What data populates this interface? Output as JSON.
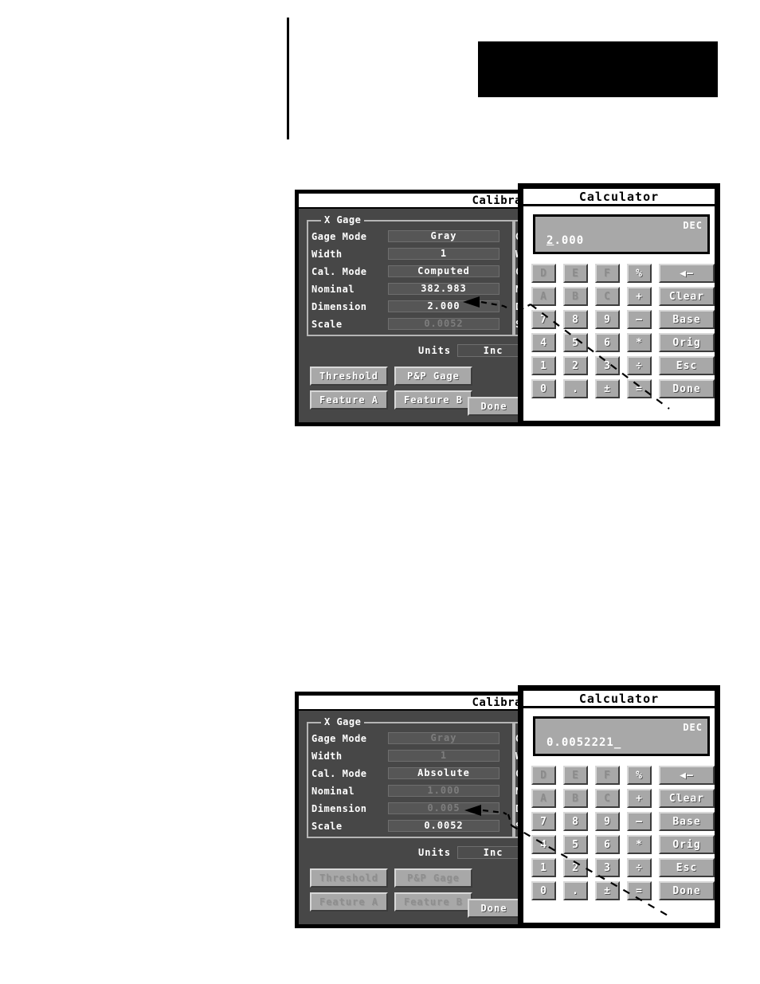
{
  "page": {
    "background": "#ffffff",
    "rule_color": "#000000"
  },
  "figures": [
    {
      "id": "figure-top",
      "calibration_window": {
        "title": "Calibra",
        "title_full_hint": "Calibra",
        "group_label": "X Gage",
        "fields": [
          {
            "label": "Gage Mode",
            "value": "Gray",
            "label_dim": false,
            "value_dim": false
          },
          {
            "label": "Width",
            "value": "1",
            "label_dim": false,
            "value_dim": false
          },
          {
            "label": "Cal. Mode",
            "value": "Computed",
            "label_dim": false,
            "value_dim": false
          },
          {
            "label": "Nominal",
            "value": "382.983",
            "label_dim": false,
            "value_dim": false
          },
          {
            "label": "Dimension",
            "value": "2.000",
            "label_dim": false,
            "value_dim": false
          },
          {
            "label": "Scale",
            "value": "0.0052",
            "label_dim": false,
            "value_dim": true
          }
        ],
        "second_gage_fields": [
          {
            "label": "G",
            "value": ""
          },
          {
            "label": "W",
            "value": ""
          },
          {
            "label": "C",
            "value": ""
          },
          {
            "label": "N",
            "value": ""
          },
          {
            "label": "D",
            "value": ""
          },
          {
            "label": "S",
            "value": ""
          }
        ],
        "units": {
          "label": "Units",
          "value": "Inc"
        },
        "buttons": [
          {
            "label": "Threshold",
            "dim": false
          },
          {
            "label": "P&P Gage",
            "dim": false
          },
          {
            "label": "Feature A",
            "dim": false
          },
          {
            "label": "Feature B",
            "dim": false
          }
        ],
        "done_label": "Done"
      },
      "calculator_window": {
        "title": "Calculator",
        "display_value": "2.000",
        "display_cursor_index": 0,
        "display_cursor_trailing": false,
        "base_label": "DEC",
        "keys": [
          [
            {
              "label": "D",
              "disabled": true,
              "wide": false
            },
            {
              "label": "E",
              "disabled": true,
              "wide": false
            },
            {
              "label": "F",
              "disabled": true,
              "wide": false
            },
            {
              "label": "%",
              "disabled": false,
              "wide": false
            },
            {
              "label": "◀–",
              "disabled": false,
              "wide": true
            }
          ],
          [
            {
              "label": "A",
              "disabled": true,
              "wide": false
            },
            {
              "label": "B",
              "disabled": true,
              "wide": false
            },
            {
              "label": "C",
              "disabled": true,
              "wide": false
            },
            {
              "label": "+",
              "disabled": false,
              "wide": false
            },
            {
              "label": "Clear",
              "disabled": false,
              "wide": true
            }
          ],
          [
            {
              "label": "7",
              "disabled": false,
              "wide": false
            },
            {
              "label": "8",
              "disabled": false,
              "wide": false
            },
            {
              "label": "9",
              "disabled": false,
              "wide": false
            },
            {
              "label": "–",
              "disabled": false,
              "wide": false
            },
            {
              "label": "Base",
              "disabled": false,
              "wide": true
            }
          ],
          [
            {
              "label": "4",
              "disabled": false,
              "wide": false
            },
            {
              "label": "5",
              "disabled": false,
              "wide": false
            },
            {
              "label": "6",
              "disabled": false,
              "wide": false
            },
            {
              "label": "*",
              "disabled": false,
              "wide": false
            },
            {
              "label": "Orig",
              "disabled": false,
              "wide": true
            }
          ],
          [
            {
              "label": "1",
              "disabled": false,
              "wide": false
            },
            {
              "label": "2",
              "disabled": false,
              "wide": false
            },
            {
              "label": "3",
              "disabled": false,
              "wide": false
            },
            {
              "label": "÷",
              "disabled": false,
              "wide": false
            },
            {
              "label": "Esc",
              "disabled": false,
              "wide": true
            }
          ],
          [
            {
              "label": "0",
              "disabled": false,
              "wide": false
            },
            {
              "label": ".",
              "disabled": false,
              "wide": false
            },
            {
              "label": "±",
              "disabled": false,
              "wide": false
            },
            {
              "label": "=",
              "disabled": false,
              "wide": false
            },
            {
              "label": "Done",
              "disabled": false,
              "wide": true
            }
          ]
        ]
      }
    },
    {
      "id": "figure-bottom",
      "calibration_window": {
        "title": "Calibra",
        "group_label": "X Gage",
        "fields": [
          {
            "label": "Gage Mode",
            "value": "Gray",
            "label_dim": false,
            "value_dim": true
          },
          {
            "label": "Width",
            "value": "1",
            "label_dim": false,
            "value_dim": true
          },
          {
            "label": "Cal. Mode",
            "value": "Absolute",
            "label_dim": false,
            "value_dim": false
          },
          {
            "label": "Nominal",
            "value": "1.000",
            "label_dim": false,
            "value_dim": true
          },
          {
            "label": "Dimension",
            "value": "0.005",
            "label_dim": false,
            "value_dim": true
          },
          {
            "label": "Scale",
            "value": "0.0052",
            "label_dim": false,
            "value_dim": false
          }
        ],
        "second_gage_fields": [
          {
            "label": "G",
            "value": ""
          },
          {
            "label": "W",
            "value": ""
          },
          {
            "label": "C",
            "value": ""
          },
          {
            "label": "N",
            "value": ""
          },
          {
            "label": "D",
            "value": ""
          },
          {
            "label": "S",
            "value": ""
          }
        ],
        "units": {
          "label": "Units",
          "value": "Inc"
        },
        "buttons": [
          {
            "label": "Threshold",
            "dim": true
          },
          {
            "label": "P&P Gage",
            "dim": true
          },
          {
            "label": "Feature A",
            "dim": true
          },
          {
            "label": "Feature B",
            "dim": true
          }
        ],
        "done_label": "Done"
      },
      "calculator_window": {
        "title": "Calculator",
        "display_value": "0.0052221",
        "display_cursor_index": -1,
        "display_cursor_trailing": true,
        "base_label": "DEC",
        "keys": [
          [
            {
              "label": "D",
              "disabled": true,
              "wide": false
            },
            {
              "label": "E",
              "disabled": true,
              "wide": false
            },
            {
              "label": "F",
              "disabled": true,
              "wide": false
            },
            {
              "label": "%",
              "disabled": false,
              "wide": false
            },
            {
              "label": "◀–",
              "disabled": false,
              "wide": true
            }
          ],
          [
            {
              "label": "A",
              "disabled": true,
              "wide": false
            },
            {
              "label": "B",
              "disabled": true,
              "wide": false
            },
            {
              "label": "C",
              "disabled": true,
              "wide": false
            },
            {
              "label": "+",
              "disabled": false,
              "wide": false
            },
            {
              "label": "Clear",
              "disabled": false,
              "wide": true
            }
          ],
          [
            {
              "label": "7",
              "disabled": false,
              "wide": false
            },
            {
              "label": "8",
              "disabled": false,
              "wide": false
            },
            {
              "label": "9",
              "disabled": false,
              "wide": false
            },
            {
              "label": "–",
              "disabled": false,
              "wide": false
            },
            {
              "label": "Base",
              "disabled": false,
              "wide": true
            }
          ],
          [
            {
              "label": "4",
              "disabled": false,
              "wide": false
            },
            {
              "label": "5",
              "disabled": false,
              "wide": false
            },
            {
              "label": "6",
              "disabled": false,
              "wide": false
            },
            {
              "label": "*",
              "disabled": false,
              "wide": false
            },
            {
              "label": "Orig",
              "disabled": false,
              "wide": true
            }
          ],
          [
            {
              "label": "1",
              "disabled": false,
              "wide": false
            },
            {
              "label": "2",
              "disabled": false,
              "wide": false
            },
            {
              "label": "3",
              "disabled": false,
              "wide": false
            },
            {
              "label": "÷",
              "disabled": false,
              "wide": false
            },
            {
              "label": "Esc",
              "disabled": false,
              "wide": true
            }
          ],
          [
            {
              "label": "0",
              "disabled": false,
              "wide": false
            },
            {
              "label": ".",
              "disabled": false,
              "wide": false
            },
            {
              "label": "±",
              "disabled": false,
              "wide": false
            },
            {
              "label": "=",
              "disabled": false,
              "wide": false
            },
            {
              "label": "Done",
              "disabled": false,
              "wide": true
            }
          ]
        ]
      }
    }
  ]
}
